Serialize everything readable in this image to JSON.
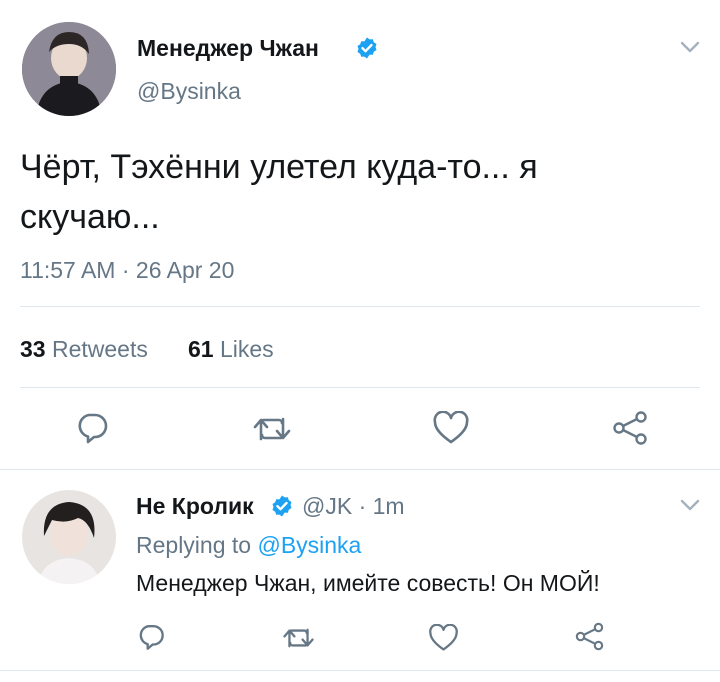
{
  "main_tweet": {
    "author_name": "Менеджер Чжан",
    "handle": "@Bysinka",
    "text_line1": "Чёрт, Тэхённи улетел куда-то... я",
    "text_line2": "скучаю...",
    "timestamp": "11:57 AM · 26 Apr 20",
    "retweets_count": "33",
    "retweets_label": "Retweets",
    "likes_count": "61",
    "likes_label": "Likes"
  },
  "reply": {
    "author_name": "Не Кролик",
    "handle": "@JK",
    "time": "· 1m",
    "replying_prefix": "Replying to",
    "replying_handle": "@Bysinka",
    "text": "Менеджер Чжан, имейте совесть! Он МОЙ!"
  },
  "icons": [
    "reply-icon",
    "retweet-icon",
    "like-icon",
    "share-icon",
    "verified-icon",
    "chevron-down-icon"
  ],
  "colors": {
    "accent": "#1da1f2",
    "muted": "#657786",
    "icon": "#667785",
    "divider": "#e1e8ed"
  }
}
